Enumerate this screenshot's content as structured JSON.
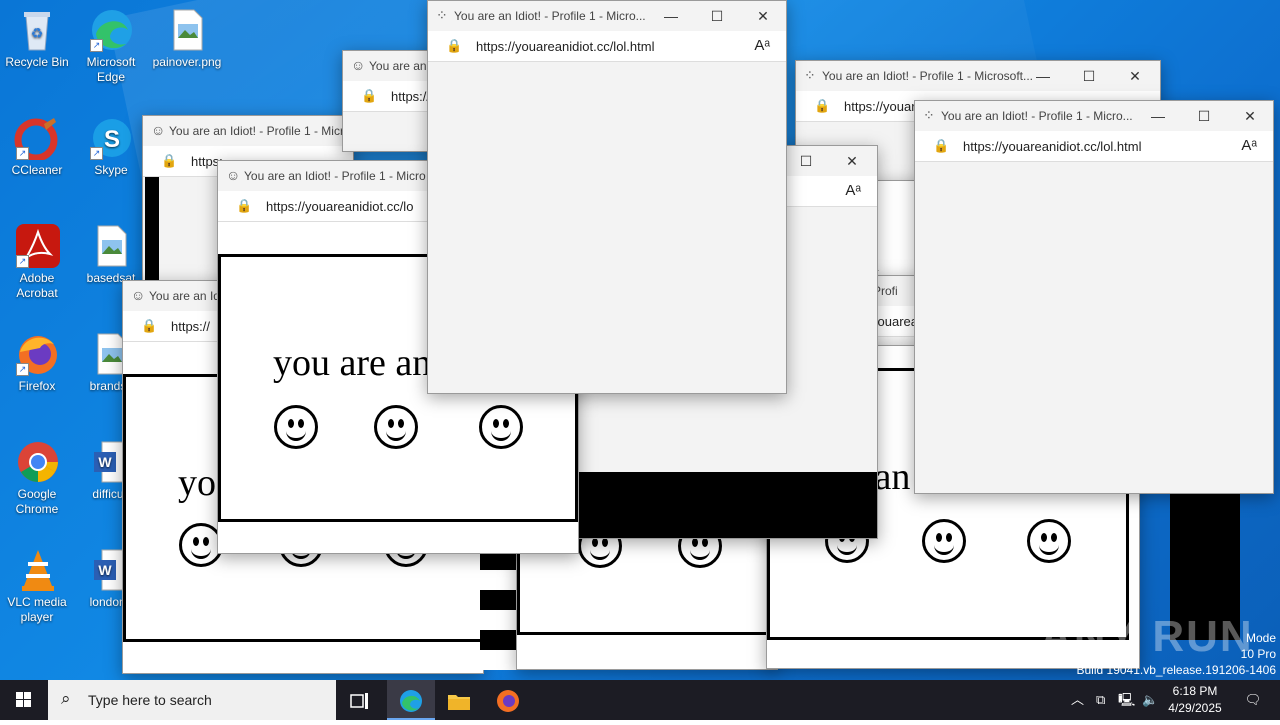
{
  "desktop": {
    "icons": [
      {
        "label": "Recycle Bin",
        "icon": "recycle-bin-icon"
      },
      {
        "label": "Microsoft Edge",
        "icon": "edge-icon"
      },
      {
        "label": "painover.png",
        "icon": "image-file-icon"
      },
      {
        "label": "CCleaner",
        "icon": "ccleaner-icon"
      },
      {
        "label": "Skype",
        "icon": "skype-icon"
      },
      {
        "label": "Adobe Acrobat",
        "icon": "acrobat-icon"
      },
      {
        "label": "basedsat",
        "icon": "image-file-icon"
      },
      {
        "label": "Firefox",
        "icon": "firefox-icon"
      },
      {
        "label": "brandss",
        "icon": "image-file-icon"
      },
      {
        "label": "Google Chrome",
        "icon": "chrome-icon"
      },
      {
        "label": "difficult",
        "icon": "word-file-icon"
      },
      {
        "label": "VLC media player",
        "icon": "vlc-icon"
      },
      {
        "label": "londone",
        "icon": "word-file-icon"
      }
    ]
  },
  "windows": {
    "title_full": "You are an Idiot! - Profile 1 - Microsoft...",
    "title_short": "You are an Idiot! - Profile 1 - Micro...",
    "title_a": "You are an Idiot! - Profile 1 - Micr",
    "title_b": "You are an Idiot! - Profile 1 - Micro",
    "title_c": "You are an Id",
    "title_d": "You are an",
    "title_e": "Yo",
    "url": "https://youareanidiot.cc/lol.html",
    "url_cut": "https://youareanidiot.cc/lo",
    "url_cut2": "https://youarear",
    "url_cut3": "https://",
    "url_cut4": "https:",
    "url_cut5": "https://youare",
    "page_text": "you are an",
    "page_text_a": "you are an",
    "page_text_b": "yo",
    "page_text_c": "ou",
    "page_text_d": "u an",
    "profile_frag": "Profi",
    "youarear": "youarear"
  },
  "taskbar": {
    "search_placeholder": "Type here to search",
    "time": "6:18 PM",
    "date": "4/29/2025"
  },
  "watermark": {
    "line1": "Mode",
    "line2": "10 Pro",
    "line3": "Build 19041.vb_release.191206-1406",
    "brand": "ANY RUN"
  }
}
